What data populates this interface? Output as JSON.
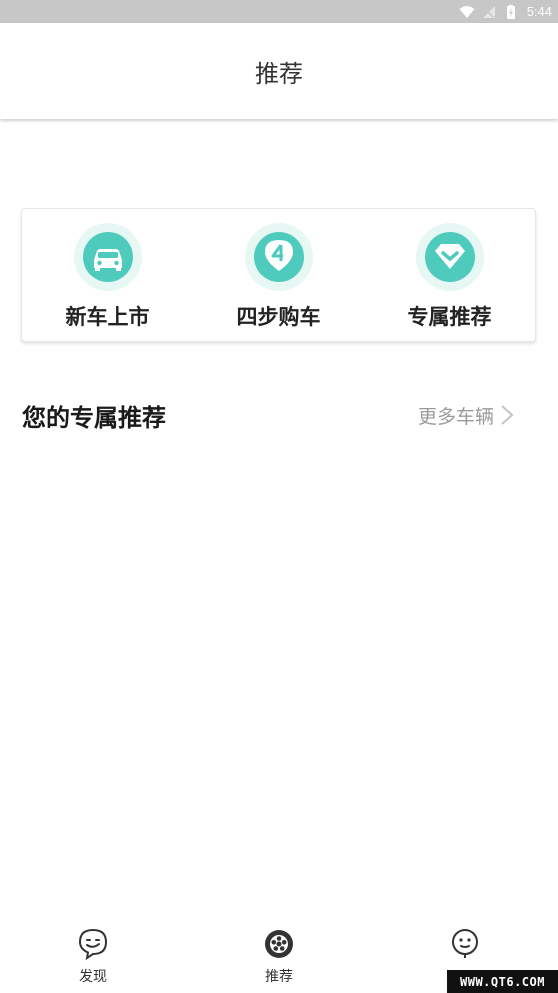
{
  "status_bar": {
    "time": "5:44"
  },
  "header": {
    "title": "推荐"
  },
  "entries": [
    {
      "label": "新车上市",
      "icon": "car-icon"
    },
    {
      "label": "四步购车",
      "icon": "step-four-icon"
    },
    {
      "label": "专属推荐",
      "icon": "heart-diamond-icon"
    }
  ],
  "section": {
    "title": "您的专属推荐",
    "more": "更多车辆"
  },
  "bottom_nav": {
    "items": [
      {
        "label": "发现",
        "icon": "chat-face-icon"
      },
      {
        "label": "推荐",
        "icon": "wheel-icon",
        "active": true
      },
      {
        "label": "",
        "icon": "profile-face-icon"
      }
    ]
  },
  "watermark": "WWW.QT6.COM",
  "colors": {
    "accent": "#4ecbbd",
    "accent_light": "#e6f7f4",
    "status_bar": "#c7c7c7"
  }
}
